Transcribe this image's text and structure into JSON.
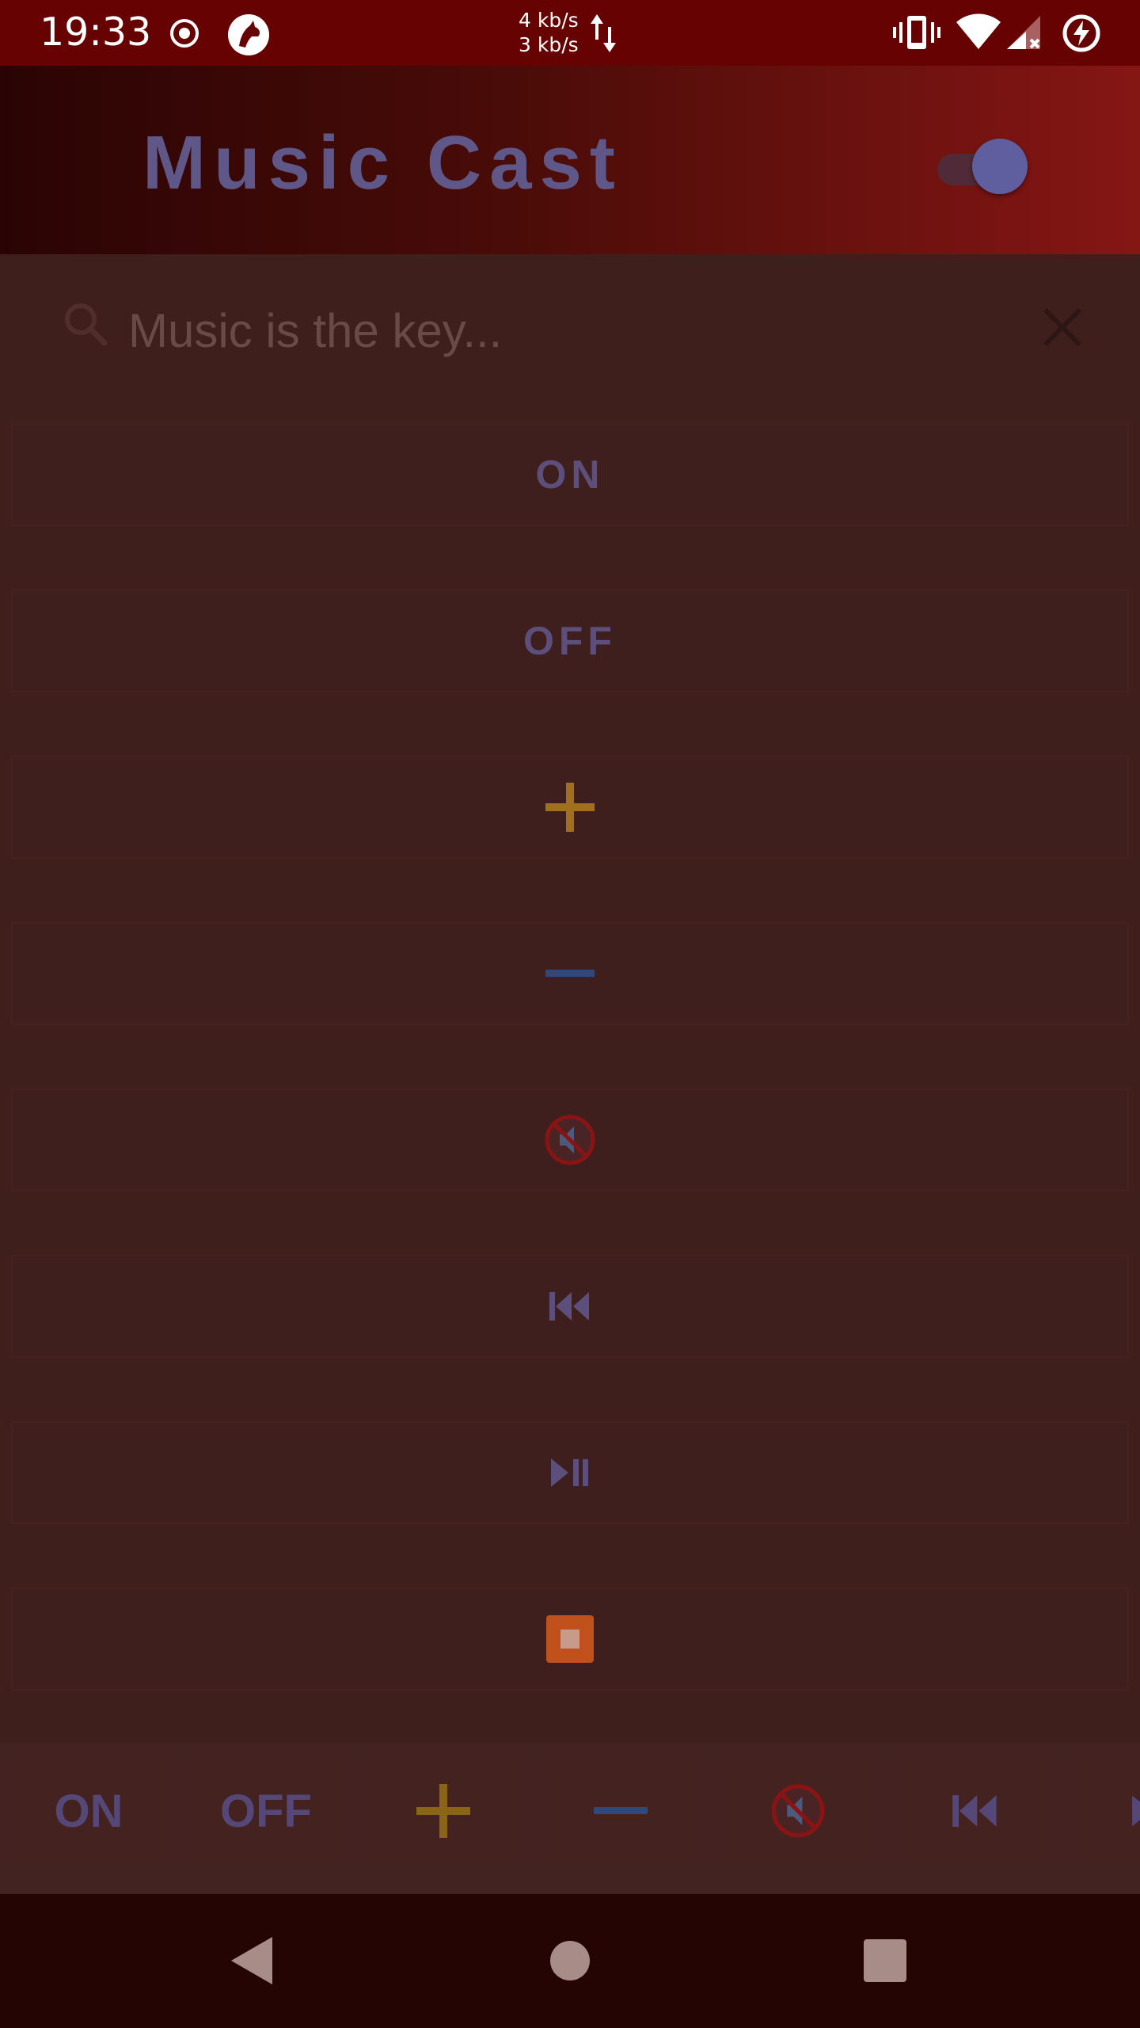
{
  "status_bar": {
    "time": "19:33",
    "net_up": "4 kb/s",
    "net_down": "3 kb/s",
    "icons": [
      "record-icon",
      "wolf-app-icon",
      "vibrate-icon",
      "wifi-icon",
      "signal-icon",
      "battery-saver-icon"
    ]
  },
  "header": {
    "title": "Music Cast",
    "toggle_on": true
  },
  "search": {
    "placeholder": "Music is the key..."
  },
  "controls": [
    {
      "label": "ON"
    },
    {
      "label": "OFF"
    },
    {
      "icon": "plus-icon"
    },
    {
      "icon": "minus-icon"
    },
    {
      "icon": "mute-icon"
    },
    {
      "icon": "previous-icon"
    },
    {
      "icon": "play-pause-icon"
    },
    {
      "icon": "stop-icon"
    }
  ],
  "bottom_bar": [
    {
      "label": "ON"
    },
    {
      "label": "OFF"
    },
    {
      "icon": "plus-icon"
    },
    {
      "icon": "minus-icon"
    },
    {
      "icon": "mute-icon"
    },
    {
      "icon": "previous-icon"
    },
    {
      "icon": "play-pause-icon"
    }
  ],
  "colors": {
    "status_bar": "#660202",
    "title": "#5e5787",
    "plus": "#a0701e",
    "minus": "#32477a",
    "stop": "#c0501c",
    "mute_ring": "#8a1414"
  },
  "nav_bar": {
    "icons": [
      "back-icon",
      "home-icon",
      "recents-icon"
    ]
  }
}
